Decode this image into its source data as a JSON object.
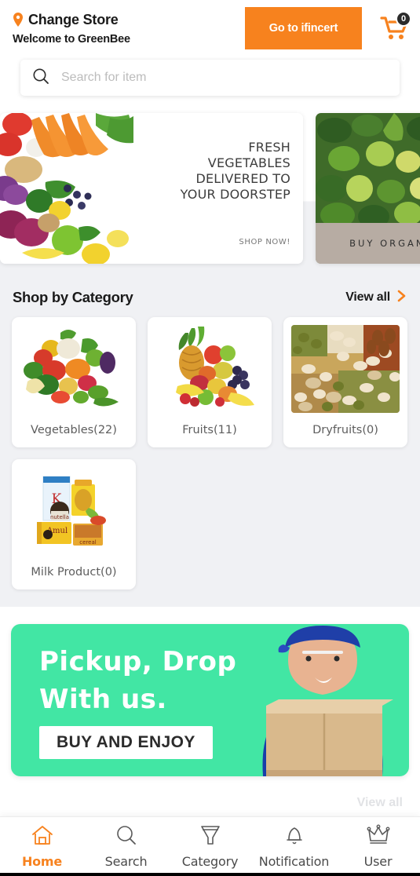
{
  "header": {
    "location_icon": "location-pin-icon",
    "store_title": "Change Store",
    "welcome": "Welcome to GreenBee",
    "cta_label": "Go to ifincert",
    "cart_icon": "shopping-cart-icon",
    "cart_count": "0"
  },
  "search": {
    "icon": "search-icon",
    "placeholder": "Search for item",
    "value": ""
  },
  "banners": [
    {
      "headline": "FRESH\nVEGETABLES\nDELIVERED TO\nYOUR DOORSTEP",
      "cta": "SHOP NOW!",
      "image": "assorted-fresh-vegetables-photo"
    },
    {
      "label": "BUY ORGANIC",
      "image": "green-vegetables-photo"
    }
  ],
  "category_section": {
    "title": "Shop by Category",
    "view_all_label": "View all",
    "view_all_icon": "chevron-right-icon",
    "items": [
      {
        "label": "Vegetables(22)",
        "image": "mixed-vegetables-photo"
      },
      {
        "label": "Fruits(11)",
        "image": "mixed-fruits-photo"
      },
      {
        "label": "Dryfruits(0)",
        "image": "assorted-nuts-photo"
      },
      {
        "label": "Milk Product(0)",
        "image": "packaged-grocery-products-photo"
      }
    ]
  },
  "promo": {
    "line1": "Pickup, Drop",
    "line2": "With us.",
    "button_label": "BUY AND ENJOY",
    "image": "delivery-man-with-box-photo"
  },
  "ghost_text": "View all",
  "bottom_nav": {
    "items": [
      {
        "label": "Home",
        "icon": "home-icon",
        "active": true
      },
      {
        "label": "Search",
        "icon": "search-icon",
        "active": false
      },
      {
        "label": "Category",
        "icon": "funnel-icon",
        "active": false
      },
      {
        "label": "Notification",
        "icon": "bell-icon",
        "active": false
      },
      {
        "label": "User",
        "icon": "crown-icon",
        "active": false
      }
    ]
  },
  "colors": {
    "accent_orange": "#f7821e",
    "promo_green": "#42e6a4",
    "page_gray": "#f0f1f4",
    "badge_dark": "#2b2b2b",
    "banner2_bar": "#b7aca3"
  }
}
